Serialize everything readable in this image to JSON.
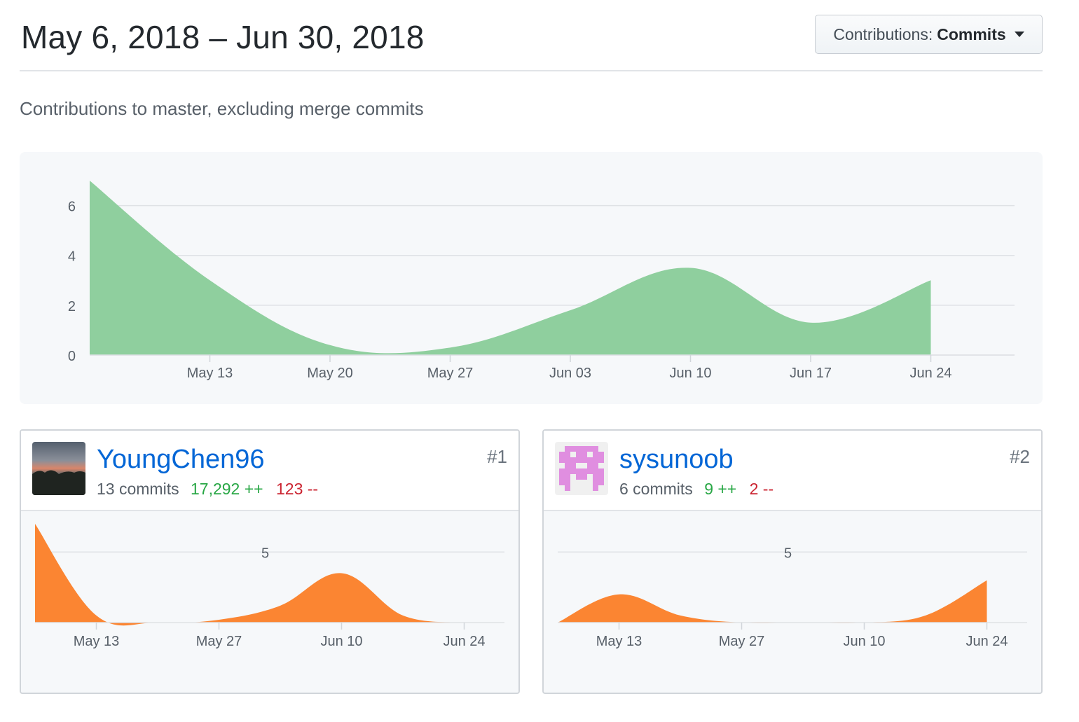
{
  "header": {
    "title": "May 6, 2018 – Jun 30, 2018",
    "dropdown_prefix": "Contributions:",
    "dropdown_value": "Commits"
  },
  "subtitle": "Contributions to master, excluding merge commits",
  "colors": {
    "main_area": "#8fcf9e",
    "contributor_area": "#fb8532",
    "link": "#0366d6",
    "additions": "#28a745",
    "deletions": "#cb2431"
  },
  "chart_data": [
    {
      "type": "area",
      "x": [
        "May 06",
        "May 13",
        "May 20",
        "May 27",
        "Jun 03",
        "Jun 10",
        "Jun 17",
        "Jun 24"
      ],
      "values": [
        7,
        3,
        0.4,
        0.3,
        1.8,
        3.5,
        1.3,
        3
      ],
      "xticks": [
        "May 13",
        "May 20",
        "May 27",
        "Jun 03",
        "Jun 10",
        "Jun 17",
        "Jun 24"
      ],
      "yticks": [
        0,
        2,
        4,
        6
      ],
      "ylim": [
        0,
        7
      ],
      "grid": true
    },
    {
      "type": "area",
      "x": [
        "May 06",
        "May 13",
        "May 20",
        "May 27",
        "Jun 03",
        "Jun 10",
        "Jun 17",
        "Jun 24"
      ],
      "values": [
        7,
        0.5,
        0,
        0.2,
        1.2,
        3.5,
        0.5,
        0
      ],
      "xticks": [
        "May 13",
        "May 27",
        "Jun 10",
        "Jun 24"
      ],
      "yticks": [
        5
      ],
      "ylim": [
        0,
        7
      ],
      "grid": true
    },
    {
      "type": "area",
      "x": [
        "May 06",
        "May 13",
        "May 20",
        "May 27",
        "Jun 03",
        "Jun 10",
        "Jun 17",
        "Jun 24"
      ],
      "values": [
        0,
        2,
        0.5,
        0,
        0,
        0,
        0.5,
        3
      ],
      "xticks": [
        "May 13",
        "May 27",
        "Jun 10",
        "Jun 24"
      ],
      "yticks": [
        5
      ],
      "ylim": [
        0,
        7
      ],
      "grid": true
    }
  ],
  "contributors": [
    {
      "name": "YoungChen96",
      "commits": "13 commits",
      "additions": "17,292 ++",
      "deletions": "123 --",
      "rank": "#1"
    },
    {
      "name": "sysunoob",
      "commits": "6 commits",
      "additions": "9 ++",
      "deletions": "2 --",
      "rank": "#2"
    }
  ]
}
